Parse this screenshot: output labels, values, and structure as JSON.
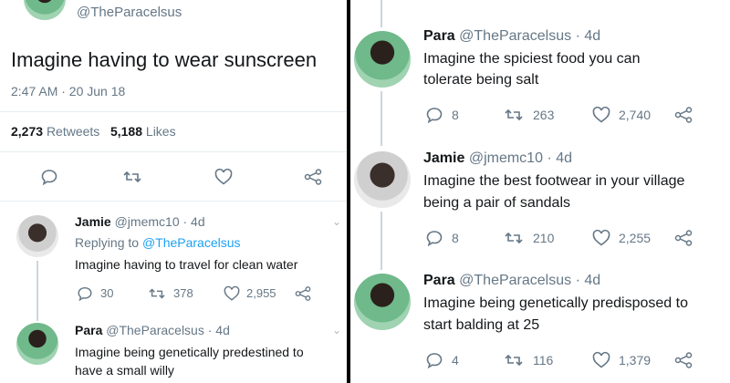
{
  "main_tweet": {
    "handle": "@TheParacelsus",
    "text": "Imagine having to wear sunscreen",
    "timestamp": "2:47 AM · 20 Jun 18",
    "retweets_count": "2,273",
    "retweets_label": "Retweets",
    "likes_count": "5,188",
    "likes_label": "Likes"
  },
  "left_replies": [
    {
      "name": "Jamie",
      "handle": "@jmemc10",
      "time": "· 4d",
      "replying_prefix": "Replying to",
      "replying_handle": "@TheParacelsus",
      "text": "Imagine having to travel for clean water",
      "replies": "30",
      "retweets": "378",
      "likes": "2,955"
    },
    {
      "name": "Para",
      "handle": "@TheParacelsus",
      "time": "· 4d",
      "text_line1": "Imagine being genetically predestined to",
      "text_line2": "have a small willy"
    }
  ],
  "right_replies": [
    {
      "name": "Para",
      "handle": "@TheParacelsus",
      "time": "· 4d",
      "text_line1": "Imagine the spiciest food you can",
      "text_line2": "tolerate being salt",
      "replies": "8",
      "retweets": "263",
      "likes": "2,740"
    },
    {
      "name": "Jamie",
      "handle": "@jmemc10",
      "time": "· 4d",
      "text_line1": "Imagine the best footwear in your village",
      "text_line2": "being a pair of sandals",
      "replies": "8",
      "retweets": "210",
      "likes": "2,255"
    },
    {
      "name": "Para",
      "handle": "@TheParacelsus",
      "time": "· 4d",
      "text_line1": "Imagine being genetically predisposed to",
      "text_line2": "start balding at 25",
      "replies": "4",
      "retweets": "116",
      "likes": "1,379"
    }
  ],
  "icons": [
    "reply-icon",
    "retweet-icon",
    "like-icon",
    "share-icon",
    "chevron-down-icon"
  ],
  "colors": {
    "link": "#1da1f2",
    "muted": "#657786",
    "text": "#14171a"
  }
}
